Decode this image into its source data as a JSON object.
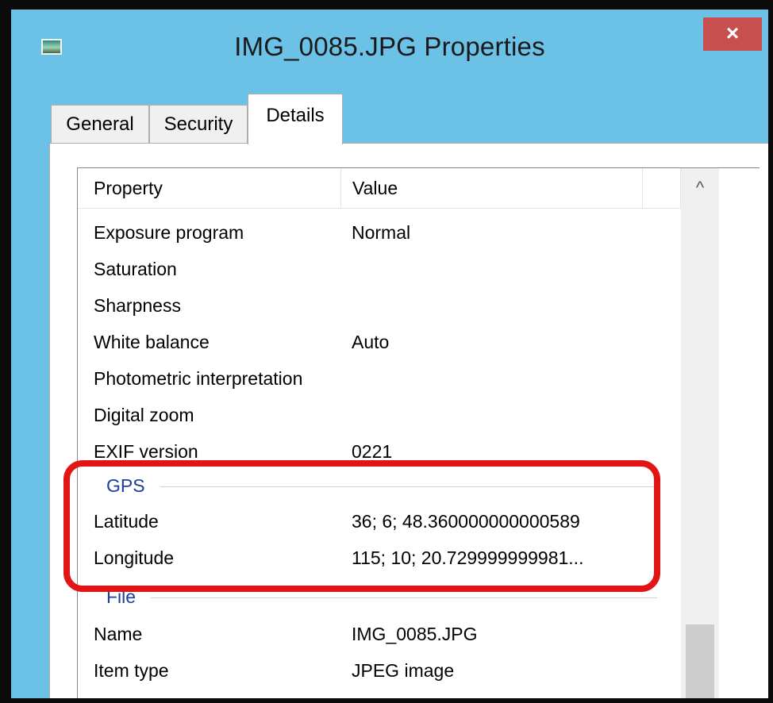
{
  "window": {
    "title": "IMG_0085.JPG Properties",
    "close_symbol": "×"
  },
  "tabs": [
    {
      "label": "General"
    },
    {
      "label": "Security"
    },
    {
      "label": "Details"
    }
  ],
  "list": {
    "headers": {
      "property": "Property",
      "value": "Value"
    },
    "rows_top": [
      {
        "property": "Exposure program",
        "value": "Normal"
      },
      {
        "property": "Saturation",
        "value": ""
      },
      {
        "property": "Sharpness",
        "value": ""
      },
      {
        "property": "White balance",
        "value": "Auto"
      },
      {
        "property": "Photometric interpretation",
        "value": ""
      },
      {
        "property": "Digital zoom",
        "value": ""
      },
      {
        "property": "EXIF version",
        "value": "0221"
      }
    ],
    "gps_group": {
      "label": "GPS",
      "rows": [
        {
          "property": "Latitude",
          "value": "36; 6; 48.360000000000589"
        },
        {
          "property": "Longitude",
          "value": "115; 10; 20.729999999981..."
        }
      ]
    },
    "file_group": {
      "label": "File",
      "rows": [
        {
          "property": "Name",
          "value": "IMG_0085.JPG"
        },
        {
          "property": "Item type",
          "value": "JPEG image"
        }
      ]
    }
  },
  "icons": {
    "app": "image-file-icon",
    "close": "close-icon",
    "scroll_up": "chevron-up-icon",
    "scroll_up_glyph": "^"
  },
  "colors": {
    "title_bar": "#6bc1e6",
    "close_button": "#c7504f",
    "group_header": "#1e3e9e",
    "highlight": "#e21515"
  }
}
